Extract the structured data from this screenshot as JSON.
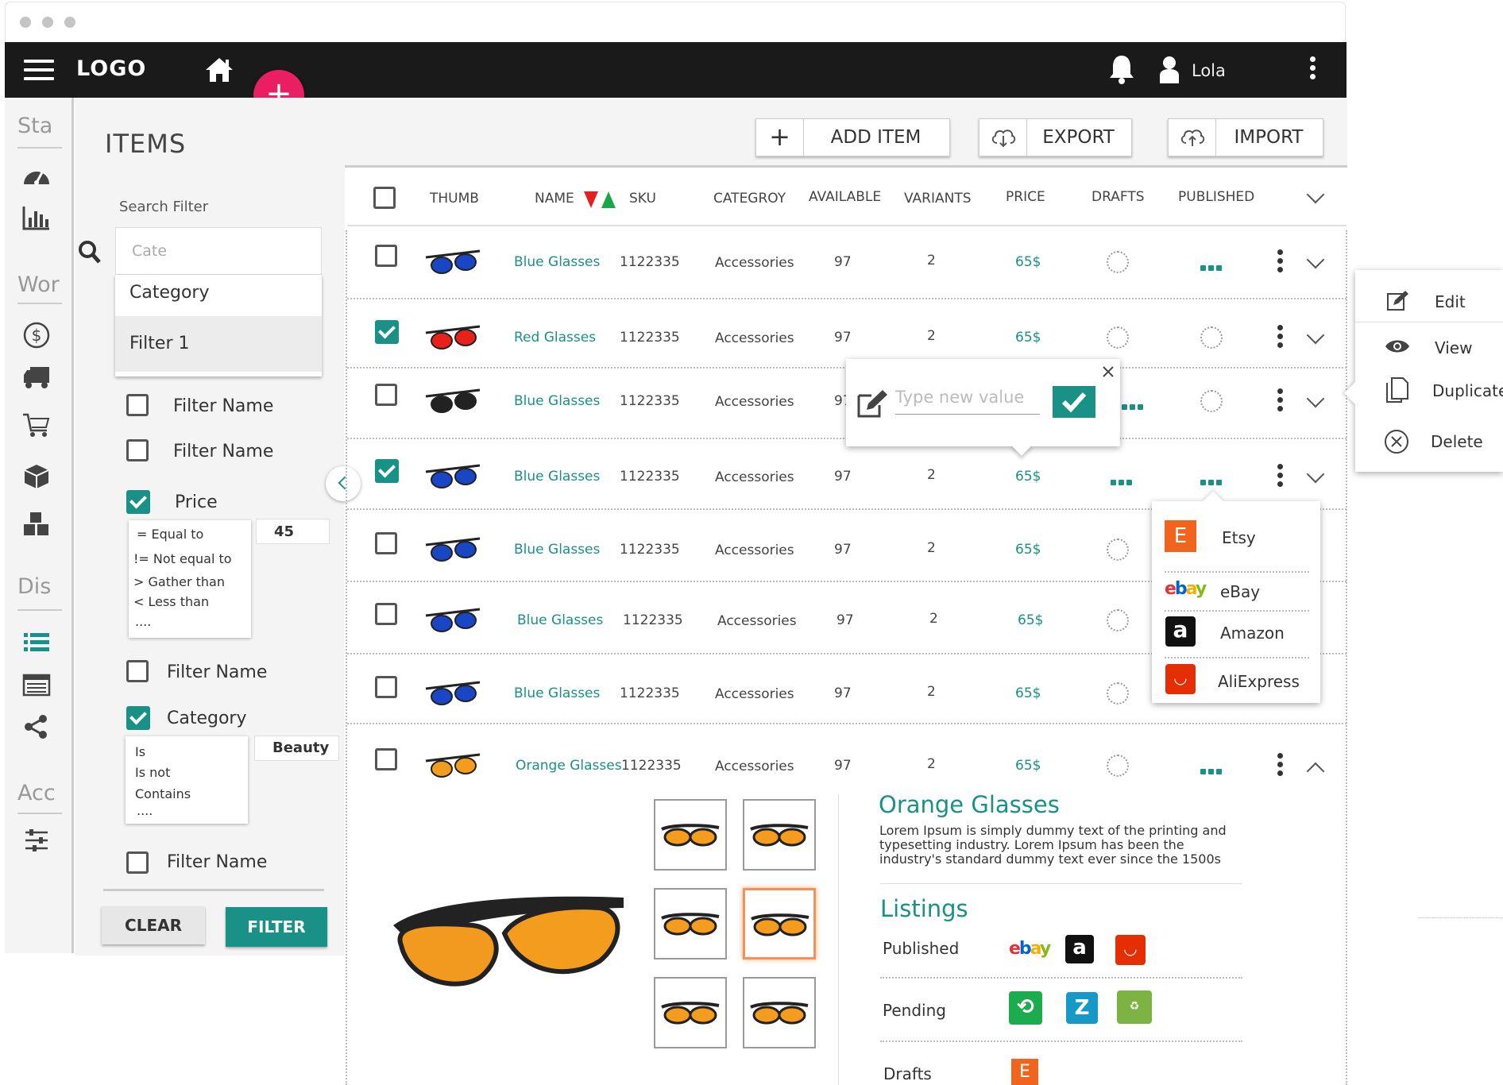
{
  "topbar": {
    "logo": "LOGO",
    "user": "Lola"
  },
  "fab": {
    "label": "+"
  },
  "sidebar": {
    "sections": [
      "Sta",
      "Wor",
      "Dis",
      "Acc"
    ],
    "icons": [
      "dashboard-icon",
      "bar-chart-icon",
      "dollar-icon",
      "truck-icon",
      "cart-icon",
      "box-icon",
      "boxes-icon",
      "list-icon",
      "table-icon",
      "share-icon",
      "sliders-icon"
    ]
  },
  "page": {
    "title": "ITEMS"
  },
  "toolbar": {
    "add_icon": "+",
    "add_label": "ADD ITEM",
    "export_label": "EXPORT",
    "import_label": "IMPORT"
  },
  "filter": {
    "search_label": "Search Filter",
    "search_value": "Cate",
    "suggestions": [
      "Category",
      "Filter 1"
    ],
    "items": [
      {
        "label": "Filter Name",
        "checked": false
      },
      {
        "label": "Filter Name",
        "checked": false
      },
      {
        "label": "Price",
        "checked": true
      },
      {
        "label": "Filter Name",
        "checked": false
      },
      {
        "label": "Category",
        "checked": true
      },
      {
        "label": "Filter Name",
        "checked": false
      }
    ],
    "price_ops": [
      "= Equal to",
      "!= Not equal to",
      "> Gather than",
      "< Less than",
      "...."
    ],
    "price_value": "45",
    "cat_ops": [
      "Is",
      "Is not",
      "Contains",
      "...."
    ],
    "cat_value": "Beauty",
    "clear": "CLEAR",
    "apply": "FILTER"
  },
  "table": {
    "headers": {
      "thumb": "THUMB",
      "name": "NAME",
      "sku": "SKU",
      "category": "CATEGROY",
      "available": "AVAILABLE",
      "variants": "VARIANTS",
      "price": "PRICE",
      "drafts": "DRAFTS",
      "published": "PUBLISHED"
    },
    "rows": [
      {
        "name": "Blue Glasses",
        "sku": "1122335",
        "category": "Accessories",
        "available": "97",
        "variants": "2",
        "price": "65$",
        "checked": false,
        "draft": "empty",
        "published": "dots"
      },
      {
        "name": "Red Glasses",
        "sku": "1122335",
        "category": "Accessories",
        "available": "97",
        "variants": "2",
        "price": "65$",
        "checked": true,
        "draft": "empty",
        "published": "empty"
      },
      {
        "name": "Blue Glasses",
        "sku": "1122335",
        "category": "Accessories",
        "available": "97",
        "variants": "2",
        "price": "65$",
        "checked": false,
        "draft": "dots",
        "published": "empty"
      },
      {
        "name": "Blue Glasses",
        "sku": "1122335",
        "category": "Accessories",
        "available": "97",
        "variants": "2",
        "price": "65$",
        "checked": true,
        "draft": "dots",
        "published": "dots"
      },
      {
        "name": "Blue Glasses",
        "sku": "1122335",
        "category": "Accessories",
        "available": "97",
        "variants": "2",
        "price": "65$",
        "checked": false,
        "draft": "empty",
        "published": "empty"
      },
      {
        "name": "Blue Glasses",
        "sku": "1122335",
        "category": "Accessories",
        "available": "97",
        "variants": "2",
        "price": "65$",
        "checked": false,
        "draft": "empty",
        "published": "empty"
      },
      {
        "name": "Blue Glasses",
        "sku": "1122335",
        "category": "Accessories",
        "available": "97",
        "variants": "2",
        "price": "65$",
        "checked": false,
        "draft": "empty",
        "published": "empty"
      },
      {
        "name": "Orange Glasses",
        "sku": "1122335",
        "category": "Accessories",
        "available": "97",
        "variants": "2",
        "price": "65$",
        "checked": false,
        "draft": "empty",
        "published": "dots"
      }
    ]
  },
  "edit_popup": {
    "placeholder": "Type new value"
  },
  "context_menu": {
    "items": [
      "Edit",
      "View",
      "Duplicate",
      "Delete"
    ]
  },
  "marketplaces": {
    "items": [
      "Etsy",
      "eBay",
      "Amazon",
      "AliExpress"
    ]
  },
  "detail": {
    "title": "Orange Glasses",
    "description": "Lorem Ipsum is simply dummy text of the printing and typesetting industry. Lorem Ipsum has been the industry's standard dummy text ever since the 1500s",
    "listings_title": "Listings",
    "published_label": "Published",
    "pending_label": "Pending",
    "drafts_label": "Drafts"
  },
  "colors": {
    "accent": "#1a9187",
    "fab": "#e91e63",
    "topbar": "#1a1a1a",
    "etsy": "#f1641e"
  }
}
